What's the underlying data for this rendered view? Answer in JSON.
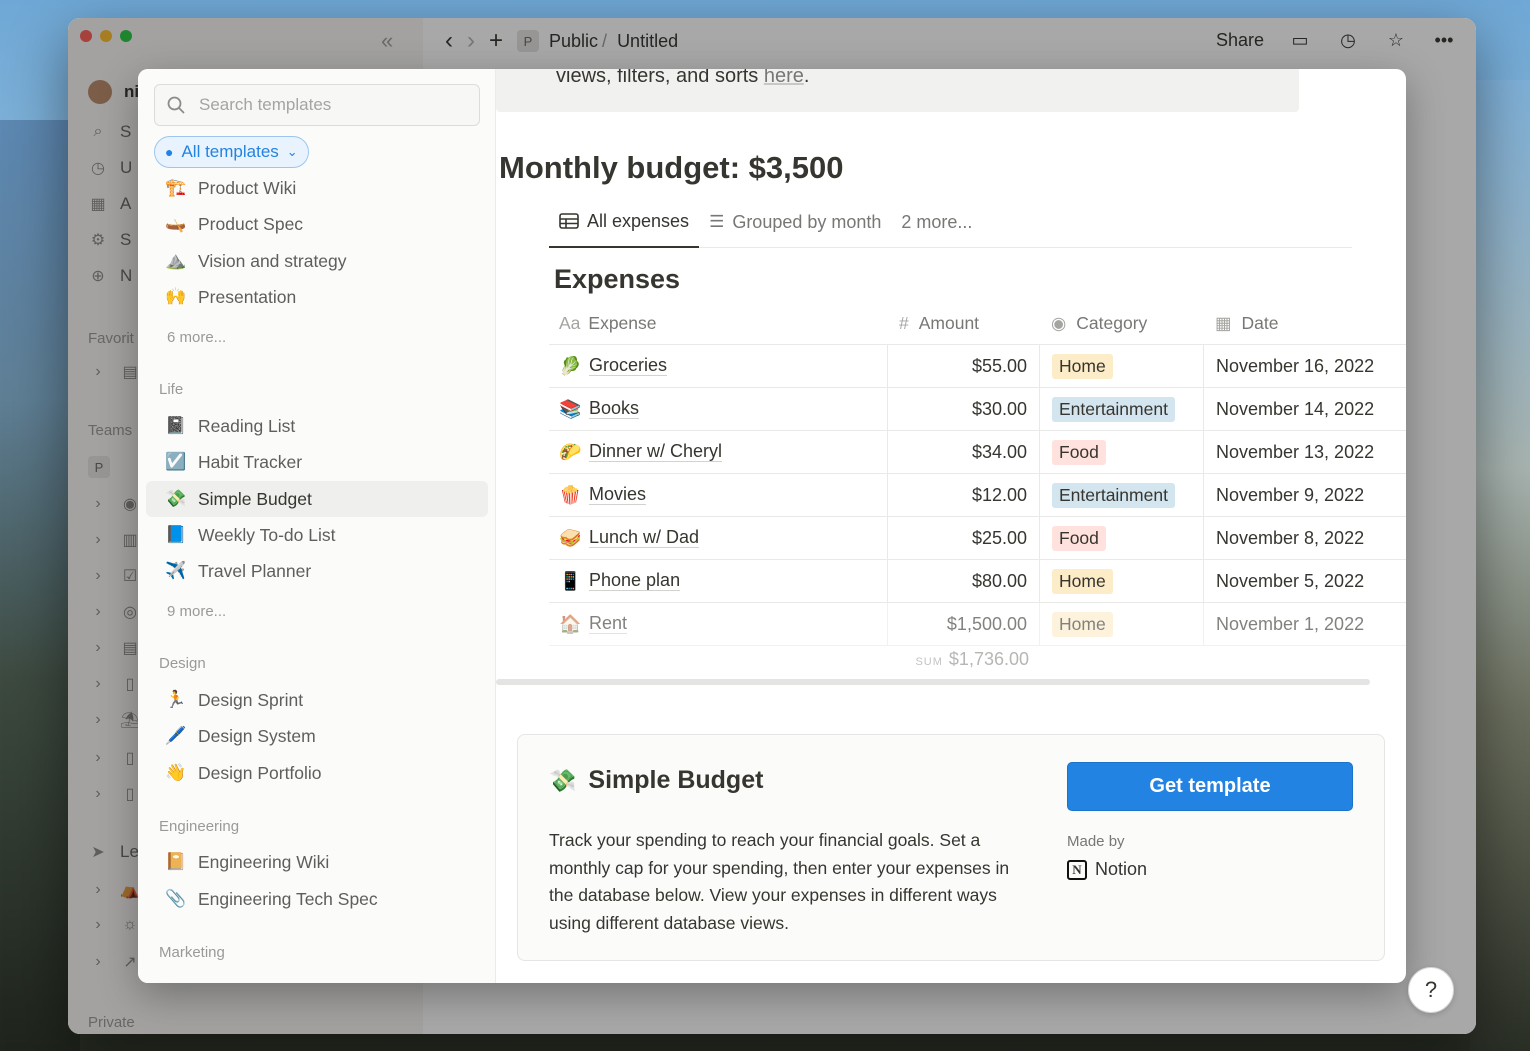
{
  "window": {
    "breadcrumb": {
      "workspace_initial": "P",
      "parent": "Public",
      "separator": "/",
      "page": "Untitled"
    },
    "share_label": "Share",
    "sidebar_peek": {
      "user_initial": "ni",
      "items": [
        "S",
        "U",
        "A",
        "S",
        "N"
      ],
      "favorites_label": "Favorit",
      "teams_label": "Teams",
      "team_initial": "P",
      "private_label": "Private",
      "team_row": "Le"
    }
  },
  "modal": {
    "search": {
      "placeholder": "Search templates",
      "value": ""
    },
    "filter_label": "All templates",
    "templates_top": [
      {
        "emoji": "🏗️",
        "label": "Product Wiki"
      },
      {
        "emoji": "🛶",
        "label": "Product Spec"
      },
      {
        "emoji": "⛰️",
        "label": "Vision and strategy"
      },
      {
        "emoji": "🙌",
        "label": "Presentation"
      }
    ],
    "more_1": "6 more...",
    "life_label": "Life",
    "templates_life": [
      {
        "emoji": "📓",
        "label": "Reading List"
      },
      {
        "emoji": "☑️",
        "label": "Habit Tracker"
      },
      {
        "emoji": "💸",
        "label": "Simple Budget"
      },
      {
        "emoji": "📘",
        "label": "Weekly To-do List"
      },
      {
        "emoji": "✈️",
        "label": "Travel Planner"
      }
    ],
    "more_2": "9 more...",
    "design_label": "Design",
    "templates_design": [
      {
        "emoji": "🏃",
        "label": "Design Sprint"
      },
      {
        "emoji": "🖊️",
        "label": "Design System"
      },
      {
        "emoji": "👋",
        "label": "Design Portfolio"
      }
    ],
    "engineering_label": "Engineering",
    "templates_engineering": [
      {
        "emoji": "📔",
        "label": "Engineering Wiki"
      },
      {
        "emoji": "📎",
        "label": "Engineering Tech Spec"
      }
    ],
    "marketing_label": "Marketing",
    "preview": {
      "callout_text": "views, filters, and sorts ",
      "callout_link": "here",
      "callout_end": ".",
      "heading": "Monthly budget: $3,500",
      "tabs": [
        "All expenses",
        "Grouped by month",
        "2 more..."
      ],
      "db_title": "Expenses",
      "columns": [
        "Expense",
        "Amount",
        "Category",
        "Date"
      ],
      "col_icons": [
        "Aa",
        "#",
        "◉",
        "▦"
      ],
      "rows": [
        {
          "emoji": "🥬",
          "name": "Groceries",
          "amount": "$55.00",
          "category": "Home",
          "date": "November 16, 2022"
        },
        {
          "emoji": "📚",
          "name": "Books",
          "amount": "$30.00",
          "category": "Entertainment",
          "date": "November 14, 2022"
        },
        {
          "emoji": "🌮",
          "name": "Dinner w/ Cheryl",
          "amount": "$34.00",
          "category": "Food",
          "date": "November 13, 2022"
        },
        {
          "emoji": "🍿",
          "name": "Movies",
          "amount": "$12.00",
          "category": "Entertainment",
          "date": "November 9, 2022"
        },
        {
          "emoji": "🥪",
          "name": "Lunch w/ Dad",
          "amount": "$25.00",
          "category": "Food",
          "date": "November 8, 2022"
        },
        {
          "emoji": "📱",
          "name": "Phone plan",
          "amount": "$80.00",
          "category": "Home",
          "date": "November 5, 2022"
        },
        {
          "emoji": "🏠",
          "name": "Rent",
          "amount": "$1,500.00",
          "category": "Home",
          "date": "November 1, 2022"
        }
      ],
      "sum_label": "SUM",
      "sum_value": "$1,736.00"
    },
    "card": {
      "emoji": "💸",
      "title": "Simple Budget",
      "description": "Track your spending to reach your financial goals. Set a monthly cap for your spending, then enter your expenses in the database below. View your expenses in different ways using different database views.",
      "button": "Get template",
      "made_by_label": "Made by",
      "maker": "Notion"
    }
  },
  "help_label": "?",
  "colors": {
    "accent": "#2383e2",
    "tag_home": "#fdecc8",
    "tag_entertainment": "#d3e5ef",
    "tag_food": "#ffe2dd"
  }
}
